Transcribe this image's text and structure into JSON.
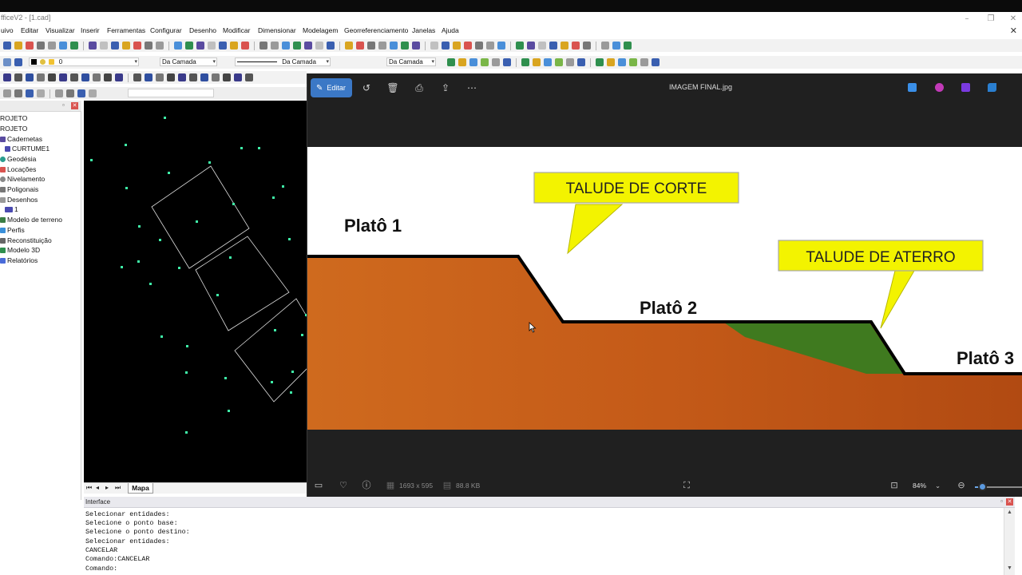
{
  "app": {
    "title": "fficeV2 - [1.cad]",
    "menu": [
      "uivo",
      "Editar",
      "Visualizar",
      "Inserir",
      "Ferramentas",
      "Configurar",
      "Desenho",
      "Modificar",
      "Dimensionar",
      "Modelagem",
      "Georreferenciamento",
      "Janelas",
      "Ajuda"
    ]
  },
  "toolbar": {
    "layer_value": "0",
    "color_mode": "Da Camada",
    "linetype_mode": "Da Camada",
    "lineweight_mode": "Da Camada"
  },
  "sidebar": {
    "items": [
      {
        "label": "ROJETO",
        "icon": "none"
      },
      {
        "label": "ROJETO",
        "icon": "none"
      },
      {
        "label": "Cadernetas",
        "icon": "notebook-icon",
        "color": "#5a4ba0"
      },
      {
        "label": "CURTUME1",
        "icon": "folder-icon",
        "color": "#4a4ab0"
      },
      {
        "label": "Geodésia",
        "icon": "globe-icon",
        "color": "#2a9d8f"
      },
      {
        "label": "Locações",
        "icon": "location-icon",
        "color": "#d9534f"
      },
      {
        "label": "Nivelamento",
        "icon": "level-icon",
        "color": "#888888"
      },
      {
        "label": "Poligonais",
        "icon": "polygon-icon",
        "color": "#777777"
      },
      {
        "label": "Desenhos",
        "icon": "drawing-icon",
        "color": "#999999"
      },
      {
        "label": "1",
        "icon": "sheet-icon",
        "color": "#4a4ab0"
      },
      {
        "label": "Modelo de terreno",
        "icon": "terrain-icon",
        "color": "#3a7d44"
      },
      {
        "label": "Perfis",
        "icon": "profile-icon",
        "color": "#3a8fd9"
      },
      {
        "label": "Reconstituição",
        "icon": "rebuild-icon",
        "color": "#666666"
      },
      {
        "label": "Modelo 3D",
        "icon": "model3d-icon",
        "color": "#2f8f4e"
      },
      {
        "label": "Relatórios",
        "icon": "report-icon",
        "color": "#4a6bd9"
      }
    ]
  },
  "cad": {
    "tab_label": "Mapa"
  },
  "console": {
    "title": "Interface",
    "lines": [
      "Selecionar entidades:",
      "Selecione o ponto base:",
      "Selecione o ponto destino:",
      "Selecionar entidades:",
      "CANCELAR",
      "Comando:CANCELAR",
      "Comando:"
    ]
  },
  "viewer": {
    "edit_label": "Editar",
    "file_name": "IMAGEM FINAL.jpg",
    "dimensions": "1693 x 595",
    "file_size": "88.8 KB",
    "zoom": "84%",
    "zoom_slider_fraction": 0.15
  },
  "image": {
    "labels": {
      "plato1": "Platô 1",
      "plato2": "Platô 2",
      "plato3": "Platô 3",
      "corte": "TALUDE DE CORTE",
      "aterro": "TALUDE DE ATERRO"
    },
    "colors": {
      "soil": "#c15a19",
      "fill": "#3f7a1f",
      "callout": "#f3f300",
      "outline": "#000000"
    }
  }
}
